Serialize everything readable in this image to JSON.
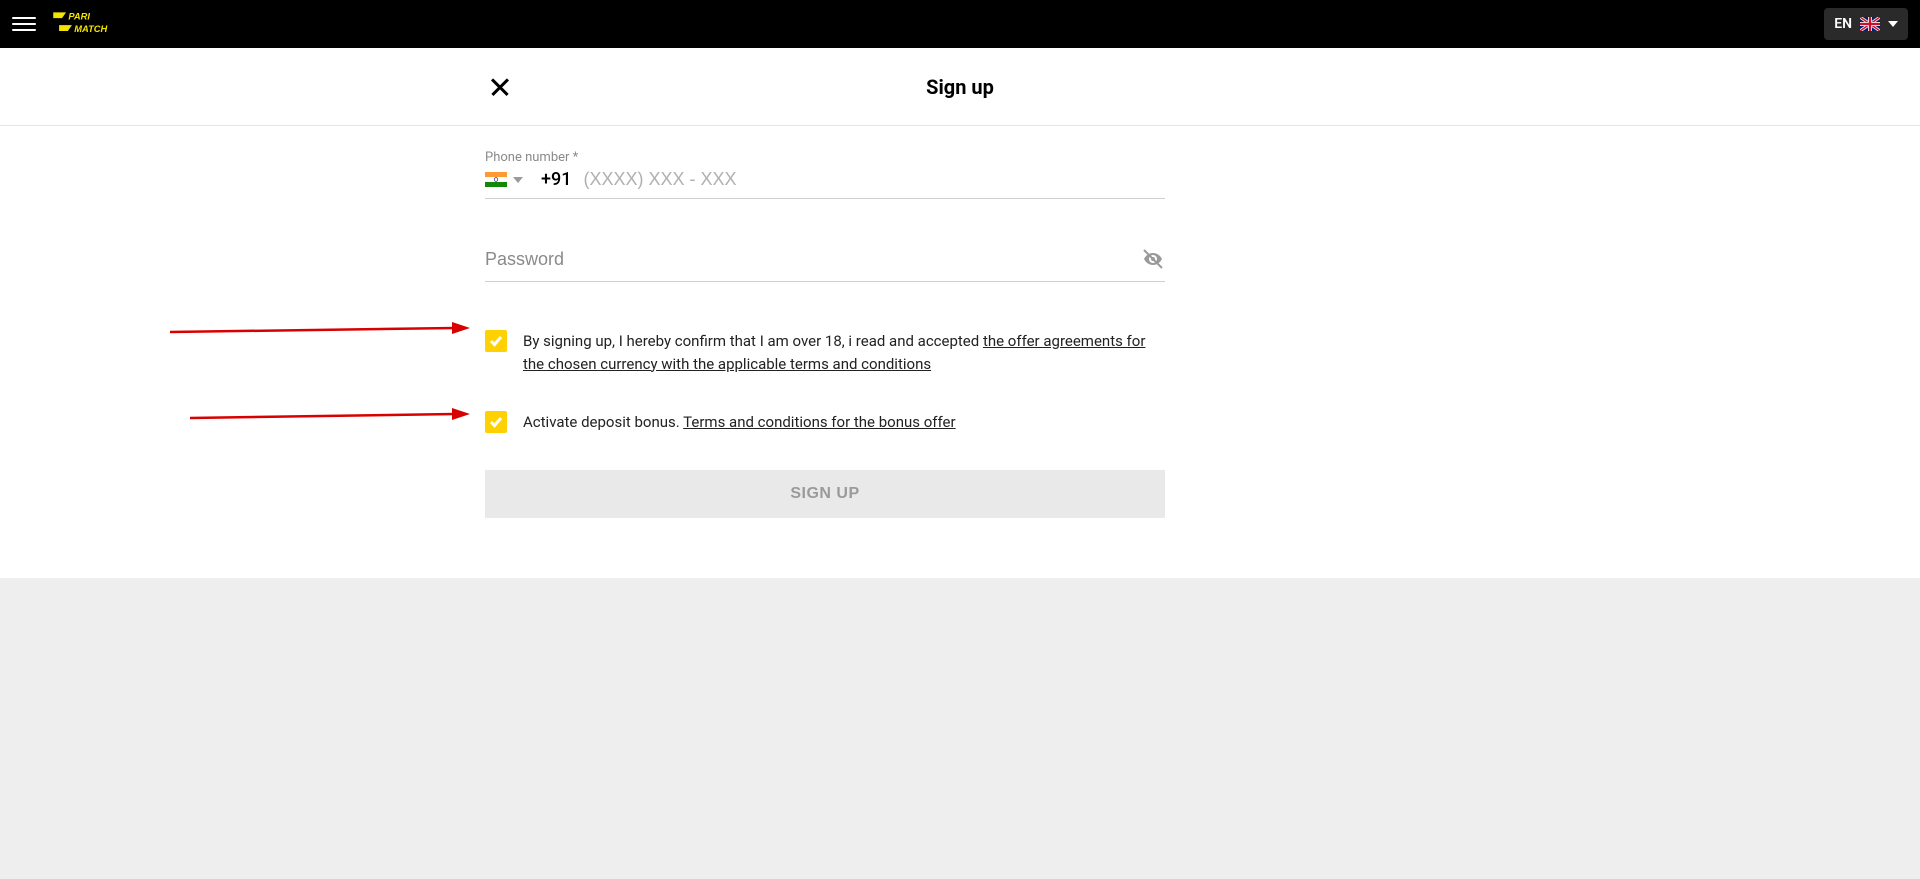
{
  "header": {
    "language_code": "EN"
  },
  "signup": {
    "title": "Sign up",
    "phone_label": "Phone number *",
    "dial_code": "+91",
    "phone_placeholder": "(XXXX) XXX - XXX",
    "password_placeholder": "Password",
    "terms_checkbox": {
      "text_prefix": "By signing up, I hereby confirm that I am over 18, i read and accepted ",
      "link_text": "the offer agreements for the chosen currency with the applicable terms and conditions"
    },
    "bonus_checkbox": {
      "text_prefix": "Activate deposit bonus. ",
      "link_text": "Terms and conditions for the bonus offer"
    },
    "submit_button": "SIGN UP"
  }
}
